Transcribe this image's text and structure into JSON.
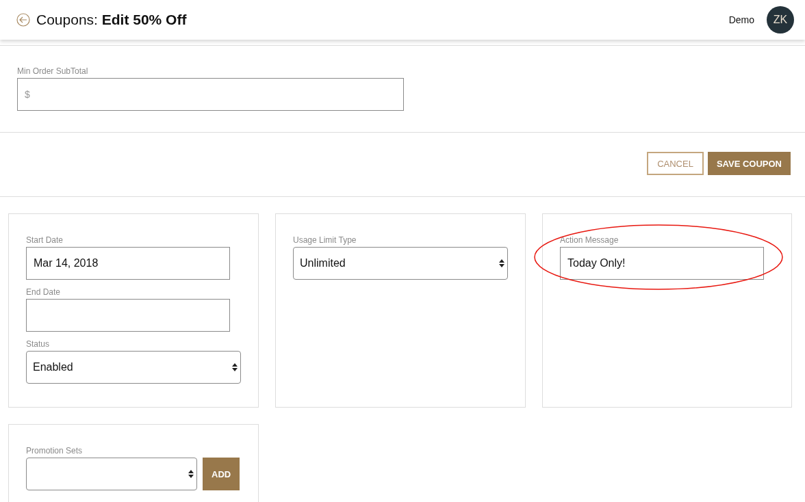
{
  "header": {
    "title": "Coupons: **Edit 50% Off**",
    "user_name": "Demo",
    "avatar_initials": "ZK"
  },
  "min_order": {
    "label": "Min Order SubTotal",
    "placeholder": "$"
  },
  "actions": [
    {
      "label": "CANCEL",
      "kind": "outline"
    },
    {
      "label": "SAVE COUPON",
      "kind": "filled"
    }
  ],
  "cards": [
    {
      "fields": [
        {
          "kind": "text",
          "label": "Start Date",
          "value": "Mar 14, 2018"
        },
        {
          "kind": "text",
          "label": "End Date"
        },
        {
          "kind": "select",
          "label": "Status",
          "value": "Enabled"
        }
      ]
    },
    {
      "fields": [
        {
          "kind": "select",
          "label": "Usage Limit Type",
          "value": "Unlimited"
        }
      ]
    },
    {
      "fields": [
        {
          "kind": "text",
          "label": "Action Message",
          "value": "Today Only!",
          "circled": true
        }
      ]
    },
    {
      "fields": [
        {
          "kind": "select_add",
          "label": "Promotion Sets",
          "button": "ADD"
        }
      ]
    }
  ]
}
